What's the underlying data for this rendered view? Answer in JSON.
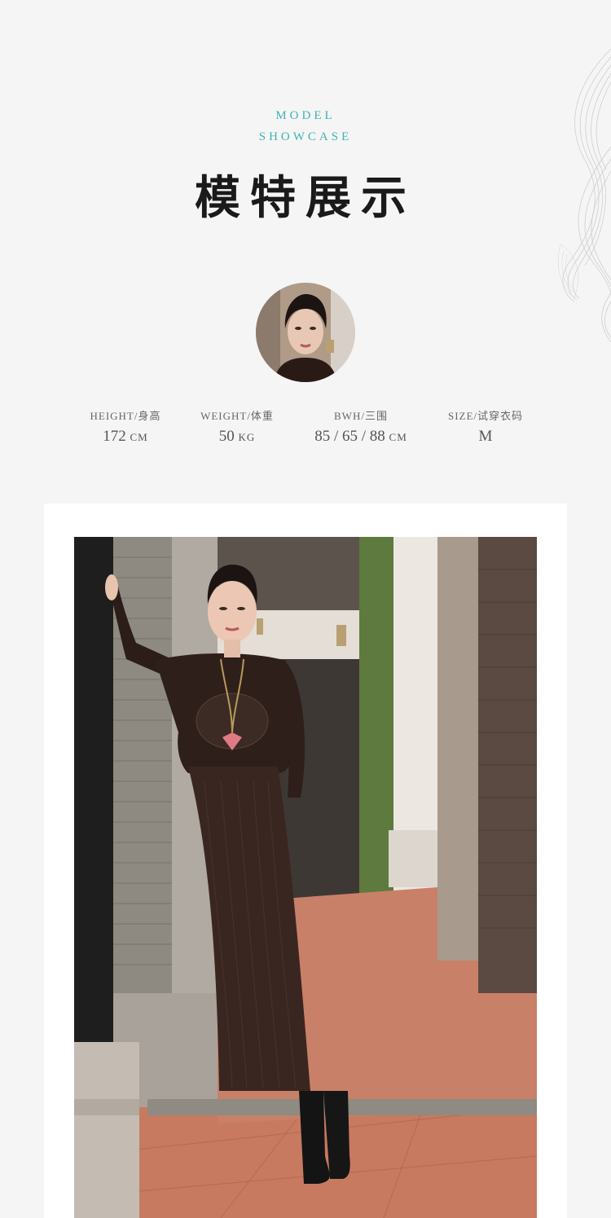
{
  "header": {
    "eyebrow_line1": "MODEL",
    "eyebrow_line2": "SHOWCASE",
    "title": "模特展示"
  },
  "model_stats": [
    {
      "label": "HEIGHT/身高",
      "value": "172",
      "unit": "CM"
    },
    {
      "label": "WEIGHT/体重",
      "value": "50",
      "unit": "KG"
    },
    {
      "label": "BWH/三围",
      "value": "85 / 65 / 88",
      "unit": "CM"
    },
    {
      "label": "SIZE/试穿衣码",
      "value": "M",
      "unit": ""
    }
  ],
  "colors": {
    "background": "#f5f5f5",
    "accent": "#3fb3b5",
    "title": "#1a1a1a",
    "dress": "#3a2620"
  }
}
